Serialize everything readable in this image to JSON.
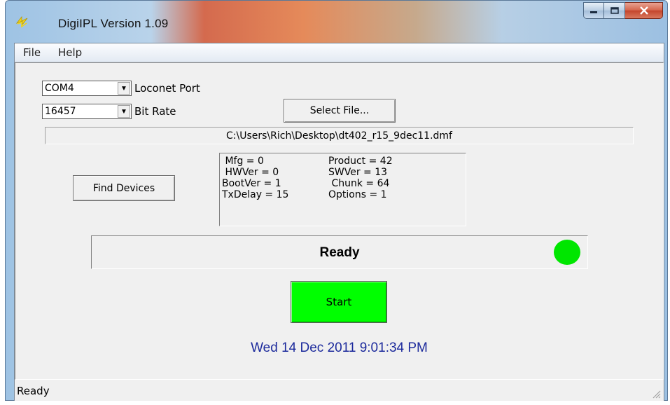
{
  "window": {
    "title": "DigiIPL  Version 1.09",
    "app_icon": "lightning-icon",
    "controls": {
      "minimize": "minimize-icon",
      "maximize": "maximize-icon",
      "close": "close-icon"
    }
  },
  "menu": {
    "items": [
      "File",
      "Help"
    ]
  },
  "port": {
    "value": "COM4",
    "label": "Loconet Port"
  },
  "bitrate": {
    "value": "16457",
    "label": "Bit Rate"
  },
  "buttons": {
    "select_file": "Select File...",
    "find_devices": "Find Devices",
    "start": "Start"
  },
  "file_path": "C:\\Users\\Rich\\Desktop\\dt402_r15_9dec11.dmf",
  "device_info": {
    "rows": [
      {
        "left": " Mfg = 0",
        "right": "Product = 42"
      },
      {
        "left": " HWVer = 0",
        "right": "SWVer = 13"
      },
      {
        "left": "BootVer = 1",
        "right": " Chunk = 64"
      },
      {
        "left": "TxDelay = 15",
        "right": "Options = 1"
      }
    ]
  },
  "status": {
    "text": "Ready",
    "indicator_color": "#00e600"
  },
  "datetime": "Wed 14 Dec 2011  9:01:34 PM",
  "statusbar": {
    "text": "Ready"
  },
  "colors": {
    "start_button": "#00ff00",
    "datetime_text": "#1c2a9c"
  }
}
